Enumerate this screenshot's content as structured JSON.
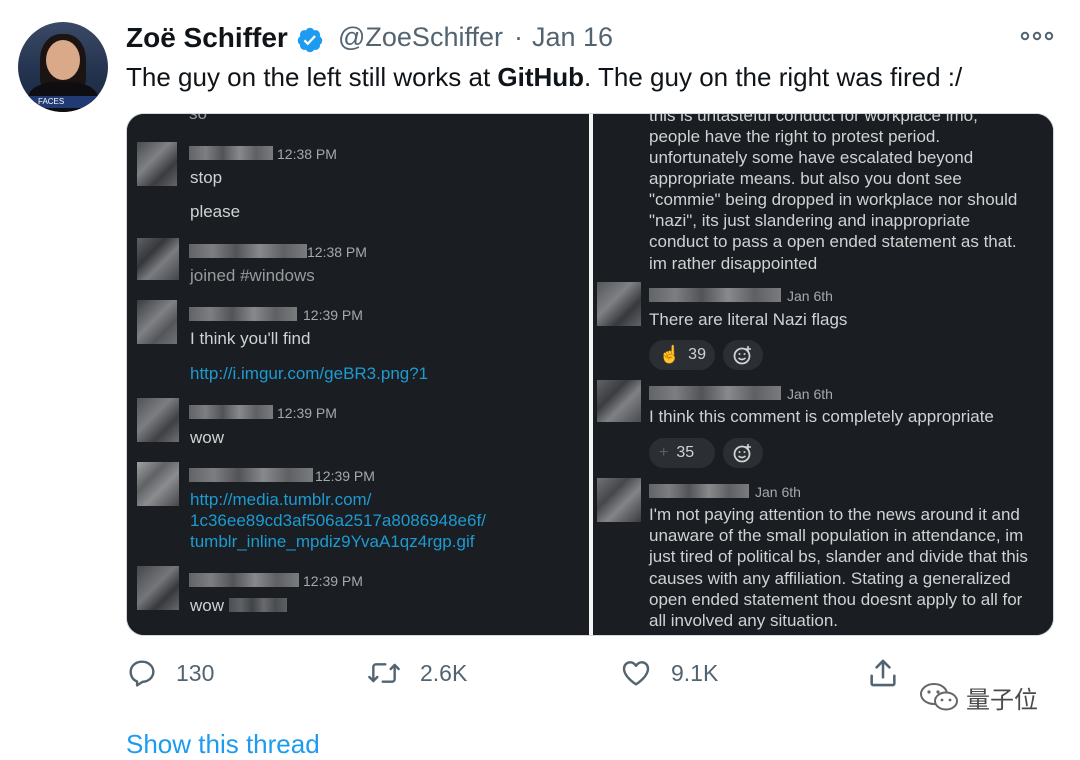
{
  "author": {
    "name": "Zoë Schiffer",
    "handle": "@ZoeSchiffer",
    "separator": "·",
    "date": "Jan 16",
    "avatar_caption": "FACES"
  },
  "tweet": {
    "text_before": "The guy on the left still works at ",
    "text_bold": "GitHub",
    "text_after": ". The guy on the right was fired :/"
  },
  "left_screenshot": {
    "top_fragment": "so",
    "messages": [
      {
        "time": "12:38 PM",
        "lines": [
          "stop",
          "please"
        ]
      },
      {
        "time": "12:38 PM",
        "lines": [
          "joined #windows"
        ]
      },
      {
        "time": "12:39 PM",
        "lines": [
          "I think you'll find",
          "http://i.imgur.com/geBR3.png?1"
        ]
      },
      {
        "time": "12:39 PM",
        "lines": [
          "wow"
        ]
      },
      {
        "time": "12:39 PM",
        "lines": [
          "http://media.tumblr.com/",
          "1c36ee89cd3af506a2517a8086948e6f/",
          "tumblr_inline_mpdiz9YvaA1qz4rgp.gif"
        ]
      },
      {
        "time": "12:39 PM",
        "lines": [
          "wow"
        ]
      }
    ]
  },
  "right_screenshot": {
    "top_block": [
      "this is untasteful conduct for workplace imo,",
      "people have the right to protest period.",
      "unfortunately some have escalated  beyond",
      "appropriate means. but also you dont see",
      "\"commie\" being dropped in workplace nor should",
      "\"nazi\", its just slandering and inappropriate",
      "conduct to pass a open ended statement as that.",
      "im rather disappointed"
    ],
    "messages": [
      {
        "time": "Jan 6th",
        "lines": [
          "There are literal Nazi flags"
        ],
        "reaction_count": "39"
      },
      {
        "time": "Jan 6th",
        "lines": [
          "I think this comment is completely appropriate"
        ],
        "reaction_count": "35"
      },
      {
        "time": "Jan 6th",
        "lines": [
          "I'm not paying attention to the news around it and",
          "unaware of the small population in attendance, im",
          "just tired of political bs, slander and divide that this",
          "causes with any affiliation. Stating a generalized",
          "open ended statement thou doesnt apply to all for",
          "all involved any situation."
        ]
      }
    ]
  },
  "actions": {
    "replies": "130",
    "retweets": "2.6K",
    "likes": "9.1K"
  },
  "watermark": "量子位",
  "show_thread": "Show this thread",
  "colors": {
    "verified": "#1d9bf0",
    "link": "#1d9bd1",
    "slack_bg": "#1a1d21"
  }
}
